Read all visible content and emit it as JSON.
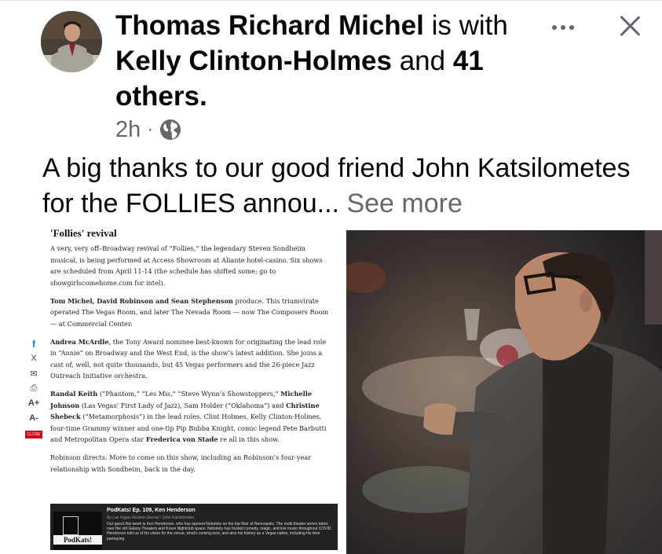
{
  "post": {
    "author": "Thomas Richard Michel",
    "with_text": "is with",
    "tagged_name": "Kelly Clinton-Holmes",
    "and_text": "and",
    "others_count": "41",
    "others_label": "others.",
    "time": "2h",
    "separator": "·",
    "caption": "A big thanks to our good friend John Katsilometes for the FOLLIES annou...",
    "see_more": "See more"
  },
  "icons": {
    "more": "more-horizontal-icon",
    "close": "close-icon",
    "audience": "globe-icon"
  },
  "article": {
    "title": "'Follies' revival",
    "p1": "A very, very off–Broadway revival of “Follies,” the legendary Steven Sondheim musical, is being performed at Access Showroom at Aliante hotel-casino. Six shows are scheduled from April 11-14 (the schedule has shifted some; go to showgirlscomehome.com for intel).",
    "p2_bold": "Tom Michel, David Robinson and Sean Stephenson",
    "p2_rest": " produce. This triumvirate operated The Vegas Room, and later The Nevada Room — now The Composers Room — at Commercial Center.",
    "p3_bold": "Andrea McArdle",
    "p3_rest": ", the Tony Award nominee best-known for originating the lead role in “Annie” on Broadway and the West End, is the show’s latest addition. She joins a cast of, well, not quite thousands, but 45 Vegas performers and the 26-piece Jazz Outreach Initiative orchestra.",
    "p4_a_bold": "Randal Keith",
    "p4_a": " (“Phantom,” “Les Mis,” “Steve Wynn’s Showstoppers,” ",
    "p4_b_bold": "Michelle Johnson",
    "p4_b": " (Las Vegas’ First Lady of Jazz), Sam Holder (“Oklahoma”) and ",
    "p4_c_bold": "Christine Shebeck",
    "p4_c": " (“Metamorphosis”) in the lead roles. Clint Holmes, Kelly Clinton-Holmes, four-time Grammy winner and one-tip Pip Bubba Knight, comic legend Pete Barbutti and Metropolitan Opera star ",
    "p4_d_bold": "Frederica von Stade",
    "p4_d": " re all in this show.",
    "p5": "Robinson directs. More to come on this show, including an Robinson’s four-year relationship with Sondheim, back in the day.",
    "share": {
      "facebook": "f",
      "x": "X",
      "email": "✉",
      "print": "⎙",
      "font_up": "A+",
      "font_down": "A-",
      "close": "CLOSE"
    },
    "podcast": {
      "title": "PodKats! Ep. 109, Ken Henderson",
      "byline": "By Las Vegas Review-Journal / John Katsilometes",
      "logo": "PodKats!",
      "desc": "Our guest this week is Ken Henderson, who has opened Notoriety on the top floor of Neonopolis. The multi-theater annex takes over the old Galaxy Theaters and Krave Nightclub space. Notoriety has hosted comedy, magic, and live music throughout COVID. Henderson told us of his vision for the venue, what's coming next, and also his history as a Vegas native, including his time portraying"
    }
  },
  "colors": {
    "text_primary": "#050505",
    "text_secondary": "#65676b",
    "facebook_blue": "#1877f2",
    "close_red": "#d0021b"
  }
}
